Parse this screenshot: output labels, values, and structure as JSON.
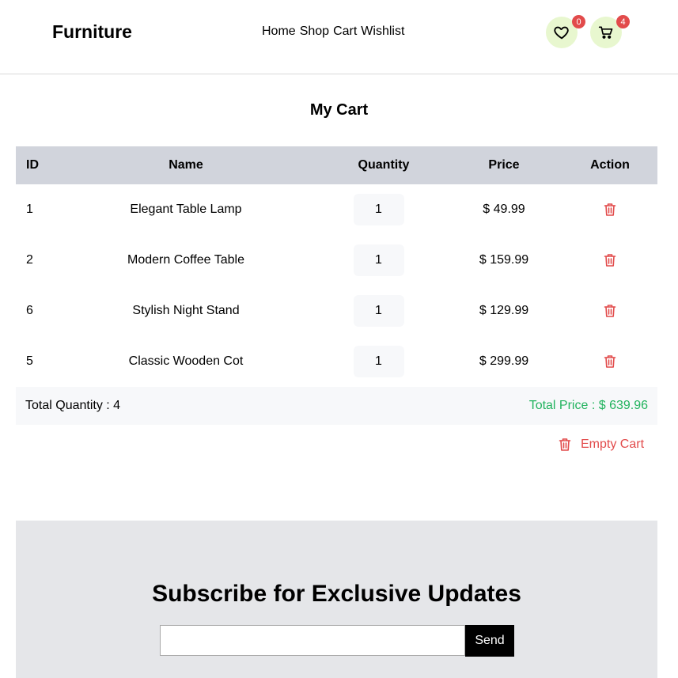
{
  "header": {
    "logo": "Furniture",
    "nav": [
      "Home",
      "Shop",
      "Cart",
      "Wishlist"
    ],
    "wishlist_count": "0",
    "cart_count": "4"
  },
  "cart": {
    "title": "My Cart",
    "columns": [
      "ID",
      "Name",
      "Quantity",
      "Price",
      "Action"
    ],
    "rows": [
      {
        "id": "1",
        "name": "Elegant Table Lamp",
        "qty": "1",
        "price": "$ 49.99"
      },
      {
        "id": "2",
        "name": "Modern Coffee Table",
        "qty": "1",
        "price": "$ 159.99"
      },
      {
        "id": "6",
        "name": "Stylish Night Stand",
        "qty": "1",
        "price": "$ 129.99"
      },
      {
        "id": "5",
        "name": "Classic Wooden Cot",
        "qty": "1",
        "price": "$ 299.99"
      }
    ],
    "total_quantity": "Total Quantity : 4",
    "total_price": "Total Price : $ 639.96",
    "empty_label": "Empty Cart"
  },
  "subscribe": {
    "title": "Subscribe for Exclusive Updates",
    "input_value": "",
    "button_label": "Send"
  },
  "icons": {
    "wishlist": "heart-icon",
    "cart": "cart-icon",
    "delete": "trash-icon"
  },
  "colors": {
    "badge": "#e24b4b",
    "icon_bg": "#e8f7cf",
    "table_header_bg": "#d1d4dc",
    "total_price": "#22b35e",
    "danger": "#e24b4b",
    "subscribe_bg": "#e5e6e9"
  }
}
